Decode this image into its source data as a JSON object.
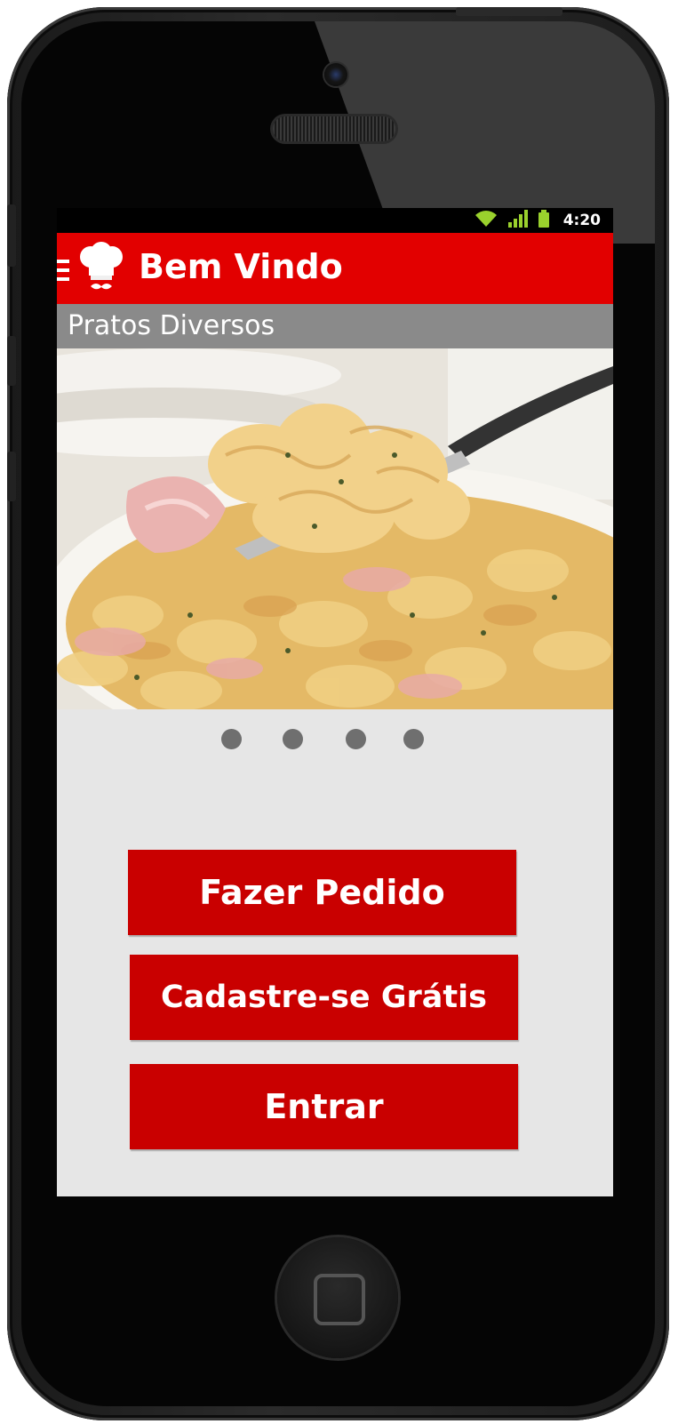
{
  "status_bar": {
    "time": "4:20",
    "icons": [
      "wifi-icon",
      "signal-icon",
      "battery-icon"
    ]
  },
  "app_bar": {
    "title": "Bem Vindo",
    "icons": [
      "drawer-icon",
      "chef-hat-icon"
    ],
    "color": "#e20000"
  },
  "section": {
    "title": "Pratos Diversos"
  },
  "carousel": {
    "image": "pasta-dish-photo",
    "page_count": 4
  },
  "actions": {
    "order_label": "Fazer Pedido",
    "signup_label": "Cadastre-se Grátis",
    "login_label": "Entrar",
    "color": "#c90000"
  }
}
